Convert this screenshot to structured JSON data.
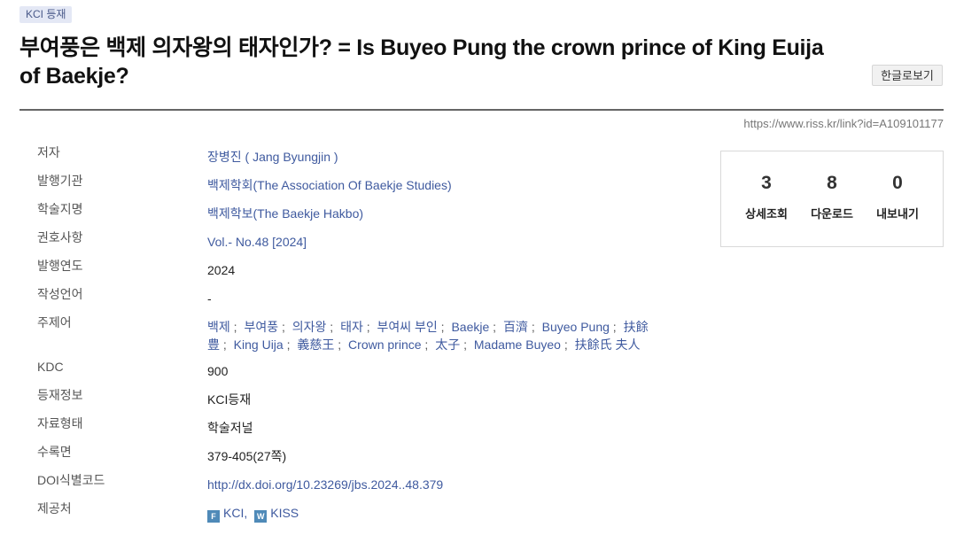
{
  "badge": "KCI 등재",
  "title": "부여풍은 백제 의자왕의 태자인가? = Is Buyeo Pung the crown prince of King Euija of Baekje?",
  "view_korean_button": "한글로보기",
  "link_url": "https://www.riss.kr/link?id=A109101177",
  "metadata": {
    "author": {
      "label": "저자",
      "value": "장병진 ( Jang Byungjin )"
    },
    "publisher": {
      "label": "발행기관",
      "value": "백제학회(The Association Of Baekje Studies)"
    },
    "journal": {
      "label": "학술지명",
      "value": "백제학보(The Baekje Hakbo)"
    },
    "issue": {
      "label": "권호사항",
      "value": "Vol.- No.48 [2024]"
    },
    "year": {
      "label": "발행연도",
      "value": "2024"
    },
    "language": {
      "label": "작성언어",
      "value": "-"
    },
    "keywords": {
      "label": "주제어",
      "items": [
        "백제",
        "부여풍",
        "의자왕",
        "태자",
        "부여씨 부인",
        "Baekje",
        "百濟",
        "Buyeo Pung",
        "扶餘豊",
        "King Uija",
        "義慈王",
        "Crown prince",
        "太子",
        "Madame Buyeo",
        "扶餘氏 夫人"
      ],
      "separator": ";"
    },
    "kdc": {
      "label": "KDC",
      "value": "900"
    },
    "registration": {
      "label": "등재정보",
      "value": "KCI등재"
    },
    "material_type": {
      "label": "자료형태",
      "value": "학술저널"
    },
    "pages": {
      "label": "수록면",
      "value": "379-405(27쪽)"
    },
    "doi": {
      "label": "DOI식별코드",
      "value": "http://dx.doi.org/10.23269/jbs.2024..48.379"
    },
    "provider": {
      "label": "제공처",
      "sources": [
        {
          "icon_letter": "F",
          "name": "KCI",
          "suffix": ","
        },
        {
          "icon_letter": "W",
          "name": "KISS",
          "suffix": ""
        }
      ]
    }
  },
  "stats": [
    {
      "value": "3",
      "label": "상세조회"
    },
    {
      "value": "8",
      "label": "다운로드"
    },
    {
      "value": "0",
      "label": "내보내기"
    }
  ],
  "colors": {
    "link": "#3f5a9f",
    "badge_bg": "#e4e8f5",
    "source_icon": "#4f8ab8"
  }
}
